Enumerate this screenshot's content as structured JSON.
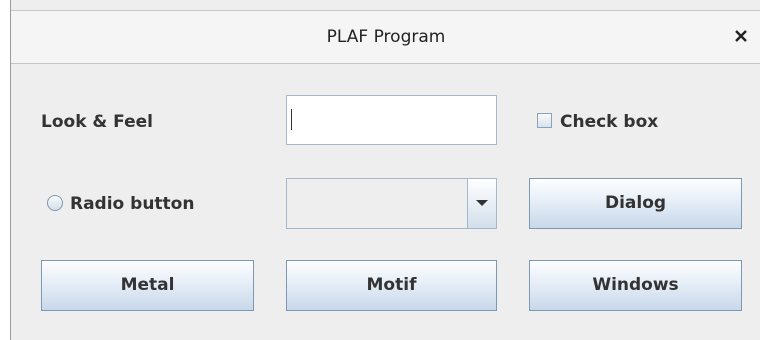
{
  "window": {
    "title": "PLAF Program",
    "close_symbol": "×"
  },
  "form": {
    "look_and_feel_label": "Look & Feel",
    "text_field_value": "",
    "checkbox_label": "Check box",
    "checkbox_checked": false,
    "radio_label": "Radio button",
    "radio_selected": false,
    "combo_value": "",
    "dialog_button": "Dialog"
  },
  "buttons": {
    "metal": "Metal",
    "motif": "Motif",
    "windows": "Windows"
  },
  "icons": {
    "close": "close-icon",
    "dropdown": "chevron-down-icon"
  }
}
